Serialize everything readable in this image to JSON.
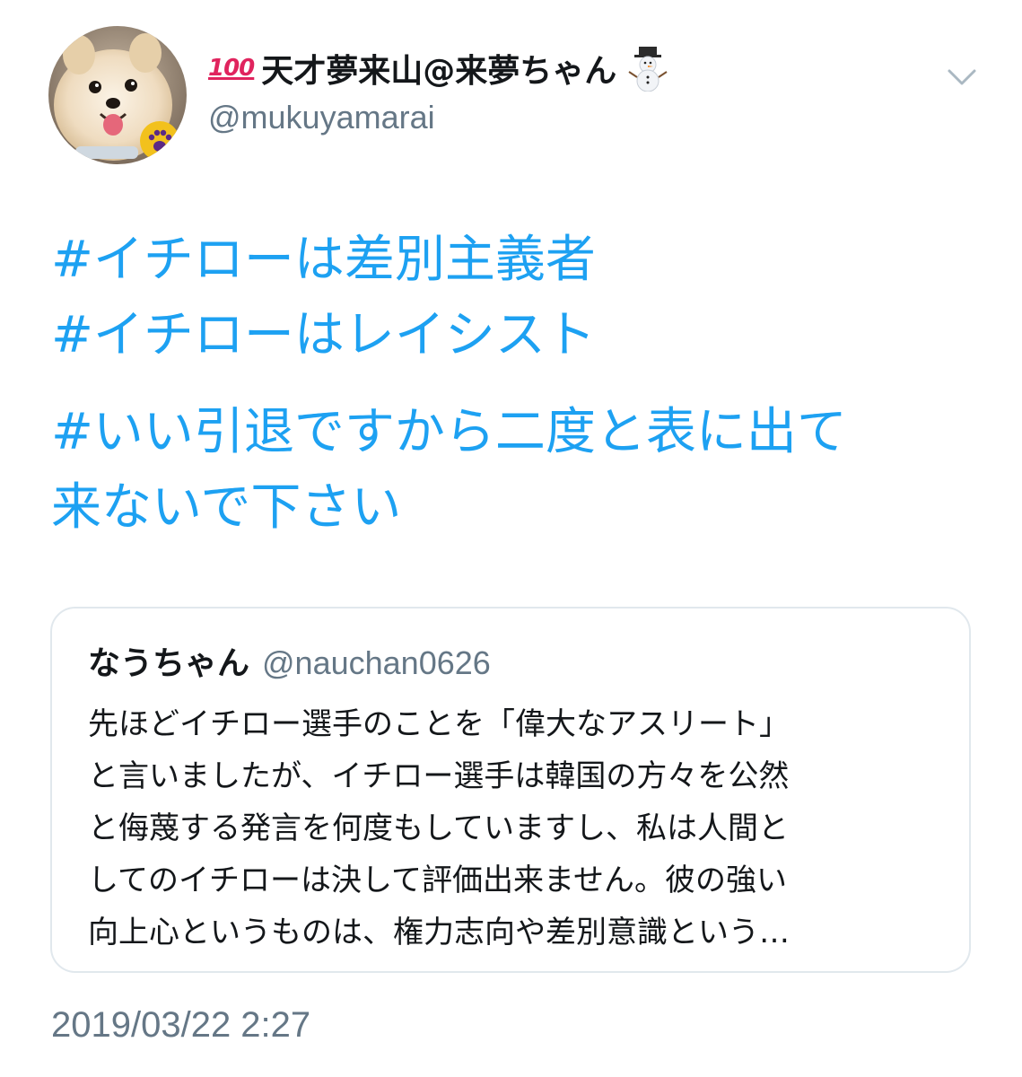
{
  "author": {
    "badge_emoji": "100",
    "display_name": "天才夢来山@来夢ちゃん",
    "handle": "@mukuyamarai"
  },
  "tweet": {
    "lines": [
      "#イチローは差別主義者",
      "#イチローはレイシスト",
      "#いい引退ですから二度と表に出て",
      "来ないで下さい"
    ],
    "timestamp": "2019/03/22 2:27"
  },
  "quoted_tweet": {
    "display_name": "なうちゃん",
    "handle": "@nauchan0626",
    "lines": [
      "先ほどイチロー選手のことを「偉大なアスリート」",
      "と言いましたが、イチロー選手は韓国の方々を公然",
      "と侮蔑する発言を何度もしていますし、私は人間と",
      "してのイチローは決して評価出来ません。彼の強い",
      "向上心というものは、権力志向や差別意識という…"
    ]
  },
  "colors": {
    "link": "#1da1f2",
    "text": "#14171a",
    "secondary": "#657786",
    "border": "#e1e8ed"
  },
  "icons": {
    "avatar": "pomeranian-dog-avatar",
    "badge": "hundred-points-emoji",
    "snowman": "snowman-emoji",
    "menu": "chevron-down-icon"
  }
}
